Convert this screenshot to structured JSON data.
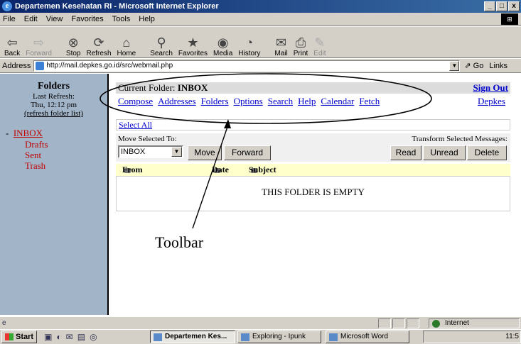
{
  "window": {
    "title": "Departemen Kesehatan RI - Microsoft Internet Explorer",
    "min": "_",
    "max": "□",
    "close": "x"
  },
  "menu": [
    "File",
    "Edit",
    "View",
    "Favorites",
    "Tools",
    "Help"
  ],
  "toolbar": [
    {
      "label": "Back",
      "icon": "back-arrow-icon",
      "glyph": "⇦",
      "enabled": true
    },
    {
      "label": "Forward",
      "icon": "forward-arrow-icon",
      "glyph": "⇨",
      "enabled": false
    },
    {
      "label": "Stop",
      "icon": "stop-icon",
      "glyph": "⊗",
      "enabled": true
    },
    {
      "label": "Refresh",
      "icon": "refresh-icon",
      "glyph": "⟳",
      "enabled": true
    },
    {
      "label": "Home",
      "icon": "home-icon",
      "glyph": "⌂",
      "enabled": true
    },
    {
      "label": "Search",
      "icon": "search-icon",
      "glyph": "⚲",
      "enabled": true
    },
    {
      "label": "Favorites",
      "icon": "favorites-icon",
      "glyph": "★",
      "enabled": true
    },
    {
      "label": "Media",
      "icon": "media-icon",
      "glyph": "◉",
      "enabled": true
    },
    {
      "label": "History",
      "icon": "history-icon",
      "glyph": "◔",
      "enabled": true
    },
    {
      "label": "Mail",
      "icon": "mail-icon",
      "glyph": "✉",
      "enabled": true
    },
    {
      "label": "Print",
      "icon": "print-icon",
      "glyph": "⎙",
      "enabled": true
    },
    {
      "label": "Edit",
      "icon": "edit-icon",
      "glyph": "✎",
      "enabled": false
    }
  ],
  "address": {
    "label": "Address",
    "url": "http://mail.depkes.go.id/src/webmail.php",
    "go": "Go",
    "links": "Links"
  },
  "sidebar": {
    "title": "Folders",
    "last_refresh_label": "Last Refresh:",
    "last_refresh_time": "Thu, 12:12 pm",
    "refresh_link": "(refresh folder list)",
    "inbox_prefix": "-",
    "inbox": "INBOX",
    "folders": [
      "Drafts",
      "Sent",
      "Trash"
    ]
  },
  "main": {
    "current_folder_label": "Current Folder:",
    "current_folder": "INBOX",
    "sign_out": "Sign Out",
    "nav": [
      "Compose",
      "Addresses",
      "Folders",
      "Options",
      "Search",
      "Help",
      "Calendar",
      "Fetch"
    ],
    "depkes": "Depkes",
    "select_all": "Select All",
    "move_label": "Move Selected To:",
    "transform_label": "Transform Selected Messages:",
    "move_select_value": "INBOX",
    "move_button": "Move",
    "forward_button": "Forward",
    "read_button": "Read",
    "unread_button": "Unread",
    "delete_button": "Delete",
    "col_from": "From",
    "col_date": "Date",
    "col_subject": "Subject",
    "empty_message": "THIS FOLDER IS EMPTY"
  },
  "annotation": {
    "label": "Toolbar"
  },
  "status": {
    "zone": "Internet"
  },
  "taskbar": {
    "start": "Start",
    "tasks": [
      "Departemen Kes...",
      "Exploring - Ipunk",
      "Microsoft Word"
    ],
    "clock": "11:5"
  }
}
